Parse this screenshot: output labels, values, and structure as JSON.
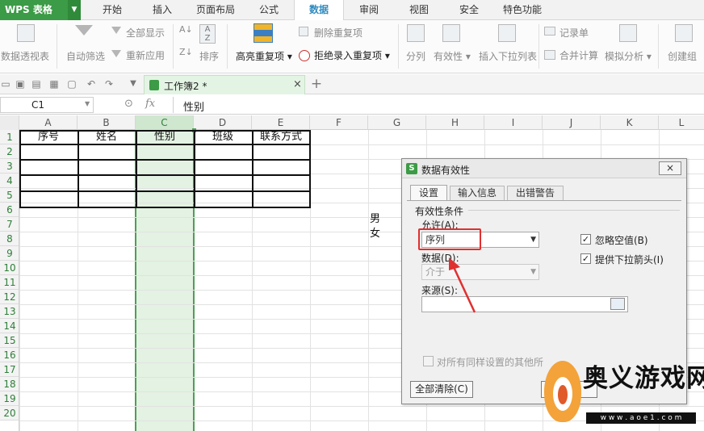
{
  "app": {
    "title": "WPS 表格"
  },
  "menu": {
    "tabs": [
      "开始",
      "插入",
      "页面布局",
      "公式",
      "数据",
      "审阅",
      "视图",
      "安全",
      "特色功能"
    ],
    "active": "数据"
  },
  "ribbon": {
    "pivot": "数据透视表",
    "autofilter": "自动筛选",
    "show_all": "全部显示",
    "reapply": "重新应用",
    "sort": "排序",
    "highlight_dup": "高亮重复项",
    "delete_dup": "删除重复项",
    "reject_dup": "拒绝录入重复项",
    "split": "分列",
    "validity": "有效性",
    "insert_dropdown": "插入下拉列表",
    "record_form": "记录单",
    "consolidate": "合并计算",
    "simulate": "模拟分析",
    "create_group": "创建组"
  },
  "doc_tab": {
    "name": "工作簿2 *"
  },
  "formula_bar": {
    "cell_ref": "C1",
    "fx": "fx",
    "content": "性别"
  },
  "grid": {
    "columns": [
      "A",
      "B",
      "C",
      "D",
      "E",
      "F",
      "G",
      "H",
      "I",
      "J",
      "K",
      "L"
    ],
    "rows": [
      "1",
      "2",
      "3",
      "4",
      "5",
      "6",
      "7",
      "8",
      "9",
      "10",
      "11",
      "12",
      "13",
      "14",
      "15",
      "16",
      "17",
      "18",
      "19",
      "20"
    ],
    "header_cells": [
      "序号",
      "姓名",
      "性别",
      "班级",
      "联系方式"
    ],
    "list_values": [
      "男",
      "女"
    ]
  },
  "dialog": {
    "title": "数据有效性",
    "tabs": [
      "设置",
      "输入信息",
      "出错警告"
    ],
    "group_label": "有效性条件",
    "allow_label": "允许(A):",
    "allow_value": "序列",
    "ignore_blank": "忽略空值(B)",
    "ignore_blank_checked": true,
    "dropdown_arrow": "提供下拉箭头(I)",
    "dropdown_arrow_checked": true,
    "data_label": "数据(D):",
    "data_value": "介于",
    "source_label": "来源(S):",
    "source_value": "",
    "apply_all": "对所有同样设置的其他所",
    "clear_all": "全部清除(C)",
    "close": "×"
  },
  "watermark": {
    "text": "奥义游戏网",
    "url": "w w w . a o e 1 . c o m"
  },
  "colors": {
    "accent_green": "#3c9b46",
    "tab_blue": "#2e8bbf",
    "highlight_red": "#e03030",
    "selection_green": "#e3f2e2"
  }
}
